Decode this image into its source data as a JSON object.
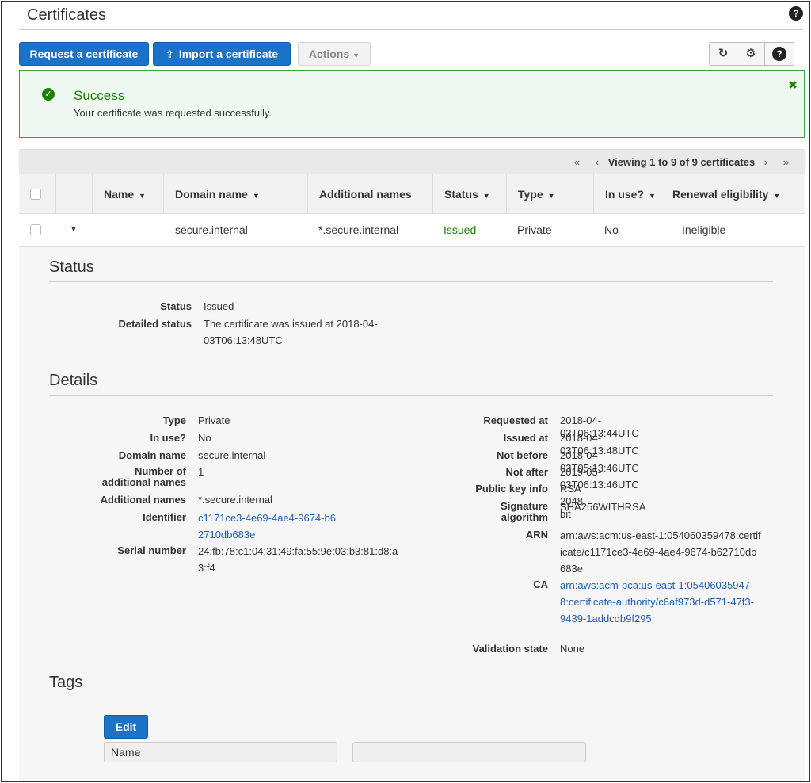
{
  "page": {
    "title": "Certificates",
    "help_icon": "question-circle-icon"
  },
  "toolbar": {
    "request_label": "Request a certificate",
    "import_label": "Import a certificate",
    "actions_label": "Actions",
    "refresh_icon": "refresh-icon",
    "settings_icon": "gear-icon",
    "help_icon": "question-circle-icon"
  },
  "alert": {
    "title": "Success",
    "message": "Your certificate was requested successfully.",
    "color": "#1d8102"
  },
  "pager": {
    "first": "«",
    "prev": "‹",
    "text": "Viewing 1 to 9 of 9 certificates",
    "next": "›",
    "last": "»"
  },
  "table": {
    "columns": [
      "Name",
      "Domain name",
      "Additional names",
      "Status",
      "Type",
      "In use?",
      "Renewal eligibility"
    ],
    "row": {
      "name": "",
      "domain": "secure.internal",
      "additional": "*.secure.internal",
      "status": "Issued",
      "type": "Private",
      "in_use": "No",
      "renewal": "Ineligible"
    }
  },
  "status_section": {
    "title": "Status",
    "status_label": "Status",
    "status_value": "Issued",
    "detailed_label": "Detailed status",
    "detailed_value": "The certificate was issued at 2018-04-03T06:13:48UTC"
  },
  "details": {
    "title": "Details",
    "type_label": "Type",
    "type_value": "Private",
    "inuse_label": "In use?",
    "inuse_value": "No",
    "domain_label": "Domain name",
    "domain_value": "secure.internal",
    "numadd_label": "Number of additional names",
    "numadd_value": "1",
    "addnames_label": "Additional names",
    "addnames_value": "*.secure.internal",
    "identifier_label": "Identifier",
    "identifier_value": "c1171ce3-4e69-4ae4-9674-b62710db683e",
    "serial_label": "Serial number",
    "serial_value": "24:fb:78:c1:04:31:49:fa:55:9e:03:b3:81:d8:a3:f4",
    "requested_label": "Requested at",
    "requested_value": "2018-04-03T06:13:44UTC",
    "issued_label": "Issued at",
    "issued_value": "2018-04-03T06:13:48UTC",
    "notbefore_label": "Not before",
    "notbefore_value": "2018-04-03T05:13:46UTC",
    "notafter_label": "Not after",
    "notafter_value": "2019-05-03T06:13:46UTC",
    "pubkey_label": "Public key info",
    "pubkey_value": "RSA 2048-bit",
    "sigalg_label": "Signature algorithm",
    "sigalg_value": "SHA256WITHRSA",
    "arn_label": "ARN",
    "arn_value": "arn:aws:acm:us-east-1:054060359478:certificate/c1171ce3-4e69-4ae4-9674-b62710db683e",
    "ca_label": "CA",
    "ca_value": "arn:aws:acm-pca:us-east-1:054060359478:certificate-authority/c6af973d-d571-47f3-9439-1addcdb9f295",
    "validation_label": "Validation state",
    "validation_value": "None"
  },
  "tags": {
    "title": "Tags",
    "edit_label": "Edit",
    "name_value": "Name",
    "value_value": ""
  }
}
